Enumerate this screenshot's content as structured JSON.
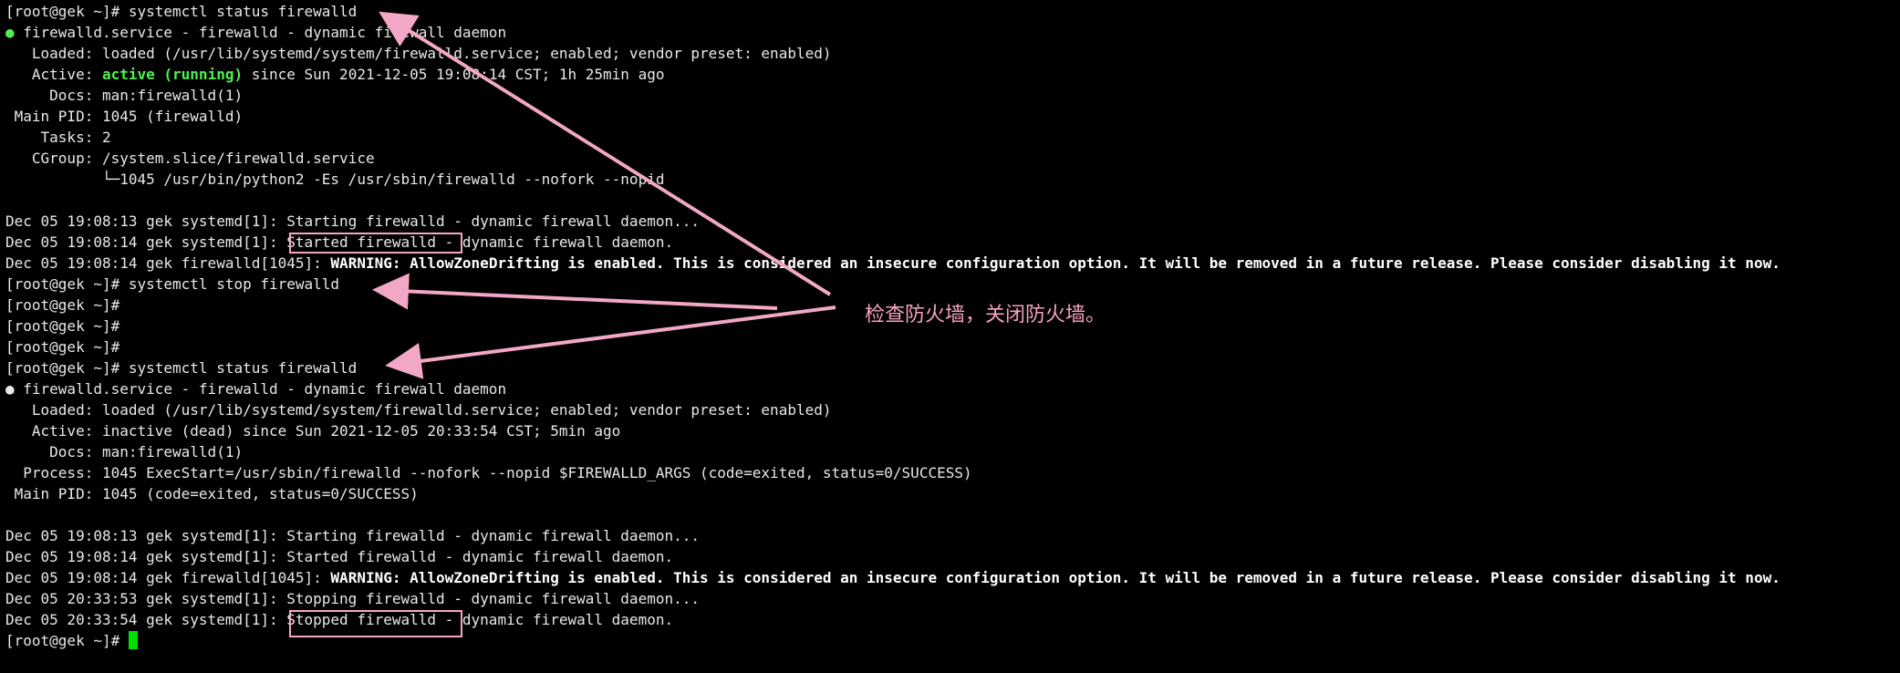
{
  "terminal": {
    "lines": [
      [
        "[root@gek ~]# systemctl status firewalld"
      ],
      [
        {
          "t": "● ",
          "c": "green"
        },
        "firewalld.service - firewalld - dynamic firewall daemon"
      ],
      [
        "   Loaded: loaded (/usr/lib/systemd/system/firewalld.service; enabled; vendor preset: enabled)"
      ],
      [
        "   Active: ",
        {
          "t": "active (running)",
          "c": "green"
        },
        " since Sun 2021-12-05 19:08:14 CST; 1h 25min ago"
      ],
      [
        "     Docs: man:firewalld(1)"
      ],
      [
        " Main PID: 1045 (firewalld)"
      ],
      [
        "    Tasks: 2"
      ],
      [
        "   CGroup: /system.slice/firewalld.service"
      ],
      [
        "           └─1045 /usr/bin/python2 -Es /usr/sbin/firewalld --nofork --nopid"
      ],
      [
        ""
      ],
      [
        "Dec 05 19:08:13 gek systemd[1]: Starting firewalld - dynamic firewall daemon..."
      ],
      [
        "Dec 05 19:08:14 gek systemd[1]: Started firewalld - dynamic firewall daemon."
      ],
      [
        "Dec 05 19:08:14 gek firewalld[1045]: ",
        {
          "t": "WARNING: AllowZoneDrifting is enabled. This is considered an insecure configuration option. It will be removed in a future release. Please consider disabling it now.",
          "c": "bold"
        }
      ],
      [
        "[root@gek ~]# systemctl stop firewalld"
      ],
      [
        "[root@gek ~]#"
      ],
      [
        "[root@gek ~]#"
      ],
      [
        "[root@gek ~]#"
      ],
      [
        "[root@gek ~]# systemctl status firewalld"
      ],
      [
        "● firewalld.service - firewalld - dynamic firewall daemon"
      ],
      [
        "   Loaded: loaded (/usr/lib/systemd/system/firewalld.service; enabled; vendor preset: enabled)"
      ],
      [
        "   Active: inactive (dead) since Sun 2021-12-05 20:33:54 CST; 5min ago"
      ],
      [
        "     Docs: man:firewalld(1)"
      ],
      [
        "  Process: 1045 ExecStart=/usr/sbin/firewalld --nofork --nopid $FIREWALLD_ARGS (code=exited, status=0/SUCCESS)"
      ],
      [
        " Main PID: 1045 (code=exited, status=0/SUCCESS)"
      ],
      [
        ""
      ],
      [
        "Dec 05 19:08:13 gek systemd[1]: Starting firewalld - dynamic firewall daemon..."
      ],
      [
        "Dec 05 19:08:14 gek systemd[1]: Started firewalld - dynamic firewall daemon."
      ],
      [
        "Dec 05 19:08:14 gek firewalld[1045]: ",
        {
          "t": "WARNING: AllowZoneDrifting is enabled. This is considered an insecure configuration option. It will be removed in a future release. Please consider disabling it now.",
          "c": "bold"
        }
      ],
      [
        "Dec 05 20:33:53 gek systemd[1]: Stopping firewalld - dynamic firewall daemon..."
      ],
      [
        "Dec 05 20:33:54 gek systemd[1]: Stopped firewalld - dynamic firewall daemon."
      ],
      [
        "[root@gek ~]# ",
        {
          "cursor": true
        }
      ]
    ]
  },
  "annotation": {
    "text": "检查防火墙，关闭防火墙。",
    "color": "#f7a0c4"
  },
  "colors": {
    "background": "#000000",
    "foreground": "#e8e8e8",
    "green": "#4ff04f",
    "cursor": "#00e000",
    "highlight": "#f3a7c6"
  }
}
